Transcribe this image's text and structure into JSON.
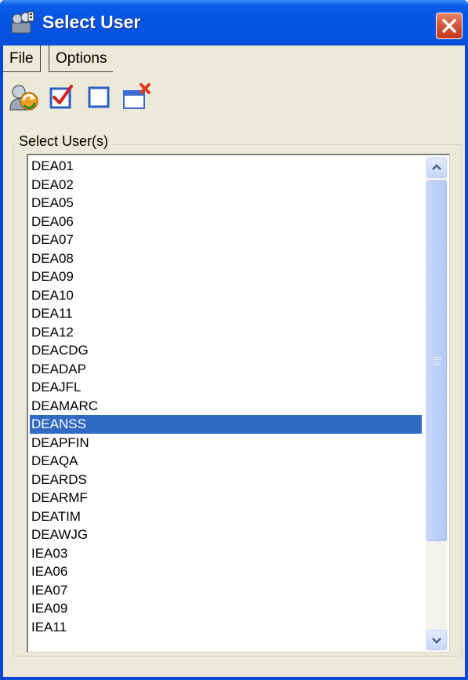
{
  "window": {
    "title": "Select User"
  },
  "menu": {
    "file": "File",
    "options": "Options"
  },
  "toolbar": {
    "buttons": [
      {
        "name": "refresh-users-icon"
      },
      {
        "name": "select-all-checkbox-icon"
      },
      {
        "name": "clear-selection-icon"
      },
      {
        "name": "close-window-icon"
      }
    ]
  },
  "group": {
    "label": "Select User(s)"
  },
  "users": [
    "DEA01",
    "DEA02",
    "DEA05",
    "DEA06",
    "DEA07",
    "DEA08",
    "DEA09",
    "DEA10",
    "DEA11",
    "DEA12",
    "DEACDG",
    "DEADAP",
    "DEAJFL",
    "DEAMARC",
    "DEANSS",
    "DEAPFIN",
    "DEAQA",
    "DEARDS",
    "DEARMF",
    "DEATIM",
    "DEAWJG",
    "IEA03",
    "IEA06",
    "IEA07",
    "IEA09",
    "IEA11"
  ],
  "selected_user": "DEANSS",
  "colors": {
    "title_bar": "#0554e3",
    "selection": "#316ac5",
    "client_background": "#ece9d8"
  }
}
